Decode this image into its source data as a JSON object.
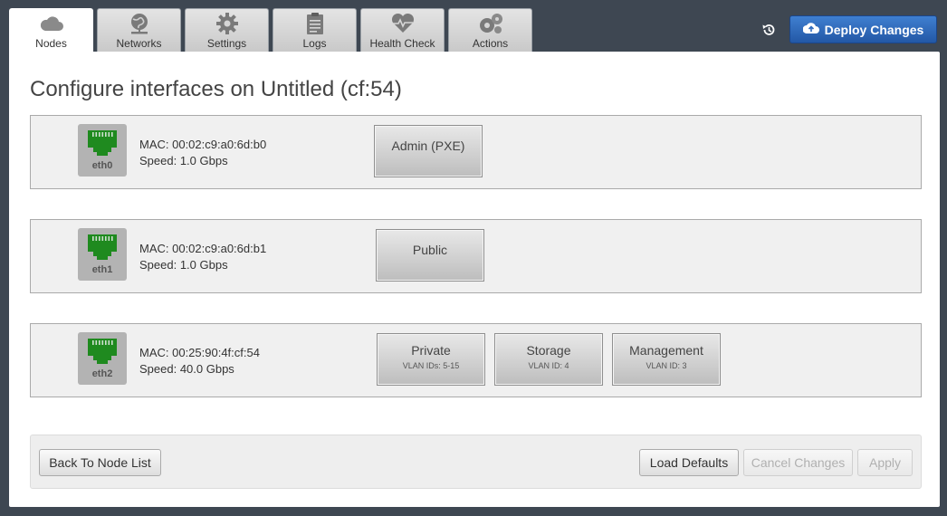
{
  "tabs": [
    {
      "label": "Nodes",
      "icon": "cloud-icon",
      "active": true
    },
    {
      "label": "Networks",
      "icon": "network-globe-icon"
    },
    {
      "label": "Settings",
      "icon": "gear-icon"
    },
    {
      "label": "Logs",
      "icon": "clipboard-icon"
    },
    {
      "label": "Health Check",
      "icon": "heart-pulse-icon"
    },
    {
      "label": "Actions",
      "icon": "gears-icon"
    }
  ],
  "header": {
    "history_icon": "history-icon",
    "deploy_label": "Deploy Changes",
    "deploy_icon": "cloud-upload-icon",
    "deploy_color": "#2f6bbf"
  },
  "page": {
    "title": "Configure interfaces on Untitled (cf:54)"
  },
  "interfaces": [
    {
      "name": "eth0",
      "mac": "MAC: 00:02:c9:a0:6d:b0",
      "speed": "Speed: 1.0 Gbps",
      "networks": [
        {
          "name": "Admin (PXE)"
        }
      ]
    },
    {
      "name": "eth1",
      "mac": "MAC: 00:02:c9:a0:6d:b1",
      "speed": "Speed:  1.0 Gbps",
      "networks": [
        {
          "name": "Public"
        }
      ]
    },
    {
      "name": "eth2",
      "mac": "MAC: 00:25:90:4f:cf:54",
      "speed": "Speed: 40.0 Gbps",
      "networks": [
        {
          "name": "Private",
          "vlan": "VLAN IDs: 5-15"
        },
        {
          "name": "Storage",
          "vlan": "VLAN ID: 4"
        },
        {
          "name": "Management",
          "vlan": "VLAN ID: 3"
        }
      ]
    }
  ],
  "port_color": "#1f8a1f",
  "footer": {
    "back_label": "Back To Node List",
    "load_defaults_label": "Load Defaults",
    "cancel_label": "Cancel Changes",
    "apply_label": "Apply"
  }
}
